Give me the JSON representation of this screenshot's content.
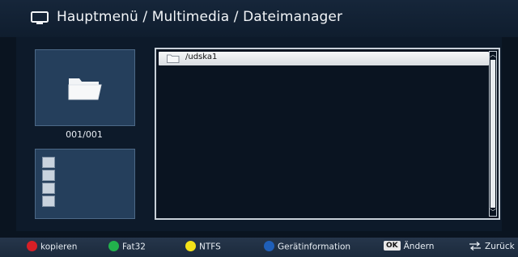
{
  "header": {
    "title": "Hauptmenü / Multimedia / Dateimanager"
  },
  "preview": {
    "counter": "001/001"
  },
  "file_list": {
    "items": [
      {
        "label": "/udska1",
        "selected": true
      }
    ]
  },
  "footer": {
    "red_label": "kopieren",
    "green_label": "Fat32",
    "yellow_label": "NTFS",
    "blue_label": "Gerätinformation",
    "ok_key": "OK",
    "ok_label": "Ändern",
    "back_label": "Zurück"
  },
  "colors": {
    "red": "#d61f26",
    "green": "#22b24c",
    "yellow": "#f3e219",
    "blue": "#1f5fb8"
  },
  "icons": {
    "header": "tv-icon",
    "preview": "folder-icon",
    "info": [
      "photo-icon",
      "person-icon",
      "document-icon",
      "music-icon"
    ]
  }
}
